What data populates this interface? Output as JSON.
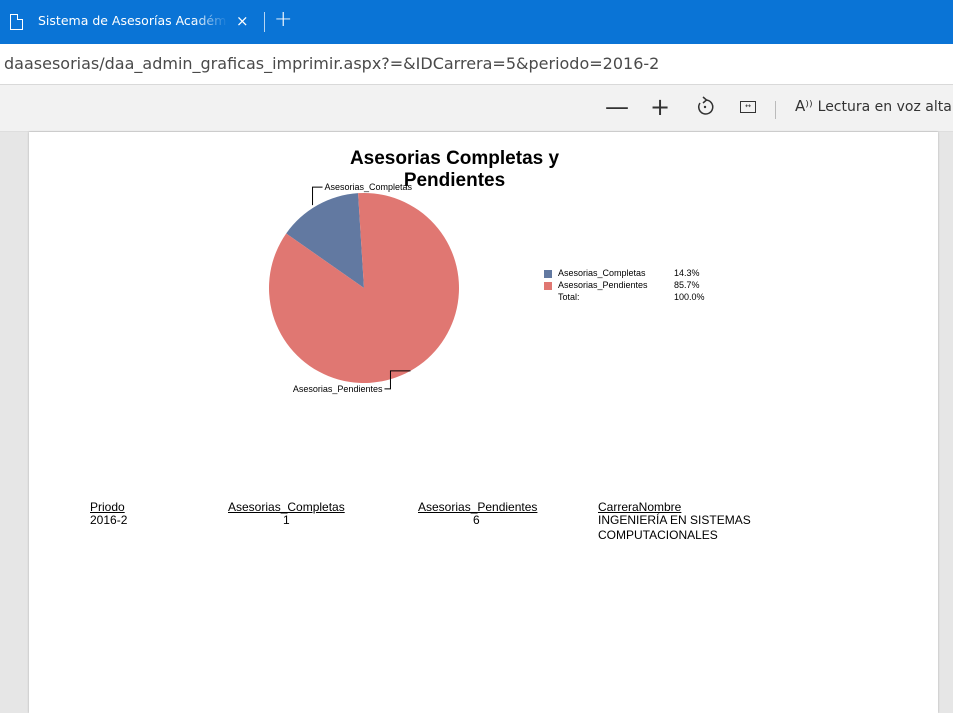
{
  "browser": {
    "tab_title": "Sistema de Asesorías Académicas",
    "tab_close": "×",
    "new_tab": "+",
    "url": "daasesorias/daa_admin_graficas_imprimir.aspx?=&IDCarrera=5&periodo=2016-2",
    "toolbar": {
      "zoom_out": "—",
      "zoom_in": "+",
      "read_aloud_label": "Lectura en voz alta"
    }
  },
  "chart_data": {
    "type": "pie",
    "title": "Asesorias Completas y Pendientes",
    "title_line1": "Asesorias Completas y",
    "title_line2": "Pendientes",
    "slices": [
      {
        "name": "Asesorias_Completas",
        "value": 1,
        "percent": "14.3%",
        "color": "#6279a1"
      },
      {
        "name": "Asesorias_Pendientes",
        "value": 6,
        "percent": "85.7%",
        "color": "#e07772"
      }
    ],
    "legend_total_label": "Total:",
    "legend_total_percent": "100.0%",
    "legend_placement": "right"
  },
  "table": {
    "headers": [
      "Priodo",
      "Asesorias_Completas",
      "Asesorias_Pendientes",
      "CarreraNombre"
    ],
    "row": {
      "periodo": "2016-2",
      "completas": "1",
      "pendientes": "6",
      "carrera_line1": "INGENIERÍA EN SISTEMAS",
      "carrera_line2": "COMPUTACIONALES"
    }
  }
}
